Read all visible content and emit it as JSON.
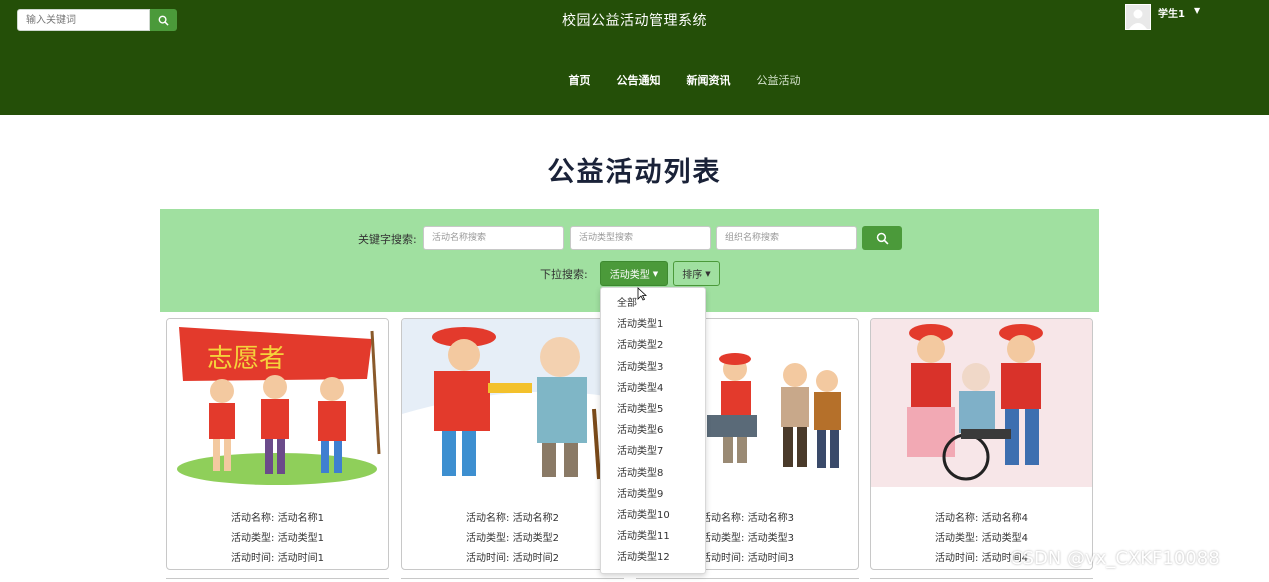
{
  "header": {
    "search_placeholder": "输入关键词",
    "site_title": "校园公益活动管理系统",
    "user_name": "学生1",
    "nav": [
      "首页",
      "公告通知",
      "新闻资讯",
      "公益活动"
    ]
  },
  "page": {
    "title": "公益活动列表"
  },
  "filters": {
    "keyword_label": "关键字搜索:",
    "name_placeholder": "活动名称搜索",
    "type_placeholder": "活动类型搜索",
    "org_placeholder": "组织名称搜索",
    "dropdown_label": "下拉搜索:",
    "type_button": "活动类型",
    "sort_button": "排序"
  },
  "dropdown_menu": [
    "全部",
    "活动类型1",
    "活动类型2",
    "活动类型3",
    "活动类型4",
    "活动类型5",
    "活动类型6",
    "活动类型7",
    "活动类型8",
    "活动类型9",
    "活动类型10",
    "活动类型11",
    "活动类型12"
  ],
  "cards": [
    {
      "name_line": "活动名称: 活动名称1",
      "type_line": "活动类型: 活动类型1",
      "time_line": "活动时间: 活动时间1"
    },
    {
      "name_line": "活动名称: 活动名称2",
      "type_line": "活动类型: 活动类型2",
      "time_line": "活动时间: 活动时间2"
    },
    {
      "name_line": "活动名称: 活动名称3",
      "type_line": "活动类型: 活动类型3",
      "time_line": "活动时间: 活动时间3"
    },
    {
      "name_line": "活动名称: 活动名称4",
      "type_line": "活动类型: 活动类型4",
      "time_line": "活动时间: 活动时间4"
    }
  ],
  "banner_text": "志愿者",
  "watermark": "CSDN @vx_CXKF10088",
  "colors": {
    "header": "#244f08",
    "accent": "#4b9a3a",
    "panel": "#a0e0a0",
    "title": "#1a2238"
  }
}
